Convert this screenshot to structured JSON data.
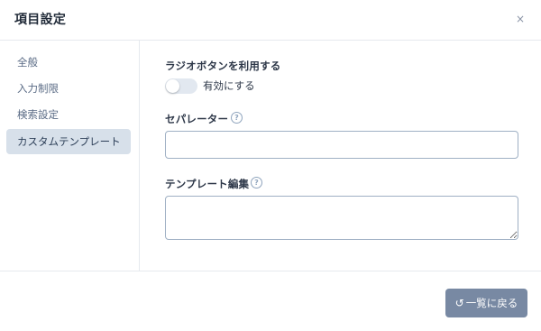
{
  "dialog": {
    "title": "項目設定",
    "close_label": "×"
  },
  "sidebar": {
    "items": [
      {
        "label": "全般",
        "active": false
      },
      {
        "label": "入力制限",
        "active": false
      },
      {
        "label": "検索設定",
        "active": false
      },
      {
        "label": "カスタムテンプレート",
        "active": true
      }
    ]
  },
  "form": {
    "radio_label": "ラジオボタンを利用する",
    "toggle_text": "有効にする",
    "toggle_on": false,
    "separator_label": "セパレーター",
    "separator_value": "",
    "template_label": "テンプレート編集",
    "template_value": "",
    "help_glyph": "?"
  },
  "footer": {
    "back_icon": "↺",
    "back_label": "一覧に戻る"
  },
  "colors": {
    "accent": "#7889a3",
    "active_nav": "#d7e0ea",
    "toggle_off": "#e2e8f0"
  }
}
